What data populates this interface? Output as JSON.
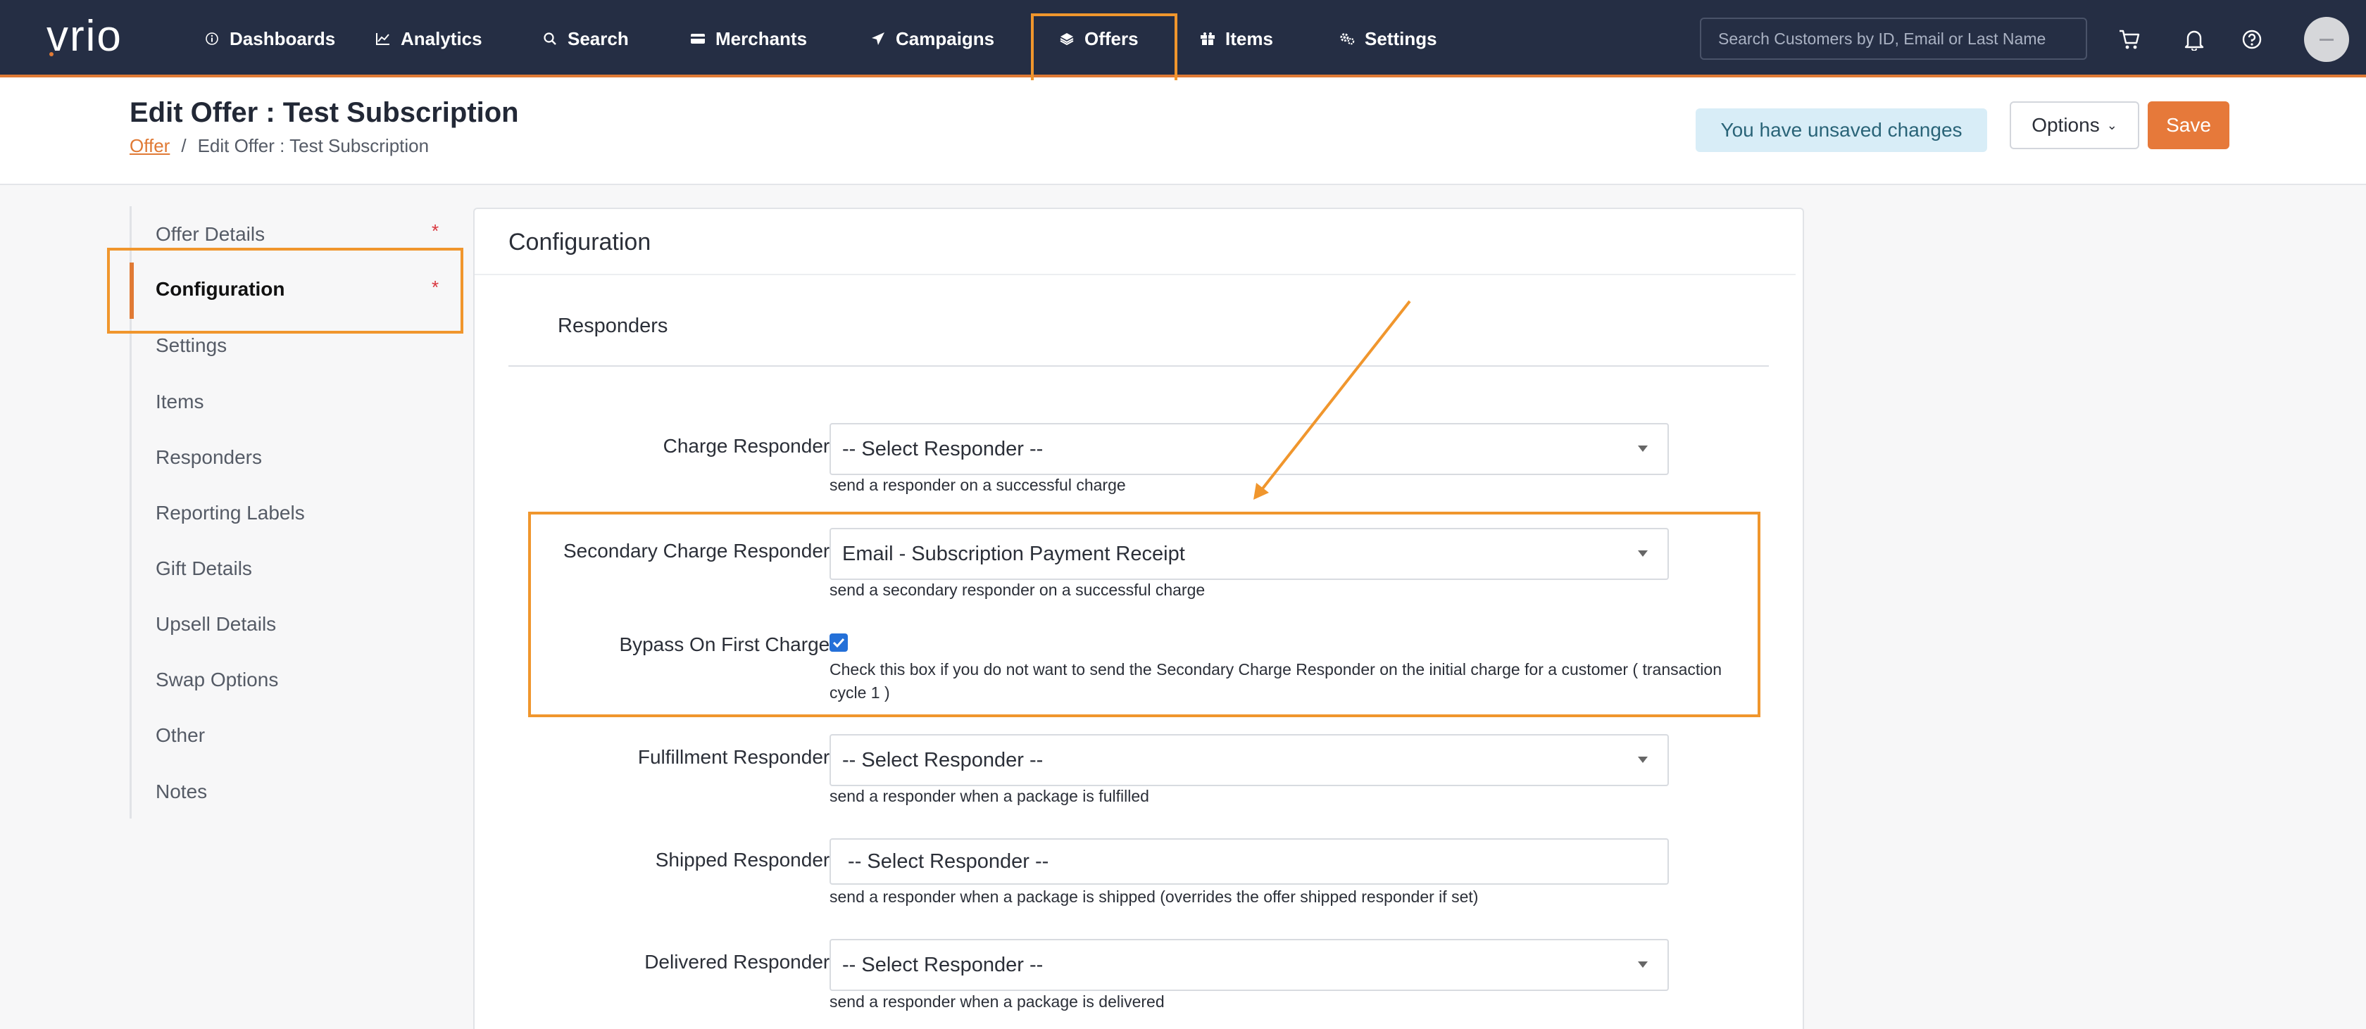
{
  "app": {
    "logo_text": "vrio"
  },
  "nav": {
    "items": [
      {
        "label": "Dashboards",
        "icon": "info-circle-icon"
      },
      {
        "label": "Analytics",
        "icon": "line-chart-icon"
      },
      {
        "label": "Search",
        "icon": "search-icon"
      },
      {
        "label": "Merchants",
        "icon": "credit-card-icon"
      },
      {
        "label": "Campaigns",
        "icon": "paper-plane-icon"
      },
      {
        "label": "Offers",
        "icon": "layers-icon"
      },
      {
        "label": "Items",
        "icon": "gift-icon"
      },
      {
        "label": "Settings",
        "icon": "gears-icon"
      }
    ],
    "search_placeholder": "Search Customers by ID, Email or Last Name",
    "highlighted_item": "Offers"
  },
  "header": {
    "title": "Edit Offer : Test Subscription",
    "breadcrumb": {
      "link": "Offer",
      "separator": "/",
      "current": "Edit Offer : Test Subscription"
    },
    "unsaved_notice": "You have unsaved changes",
    "options_label": "Options",
    "save_label": "Save"
  },
  "sidenav": {
    "items": [
      {
        "label": "Offer Details",
        "required": "*"
      },
      {
        "label": "Configuration",
        "required": "*",
        "active": true
      },
      {
        "label": "Settings"
      },
      {
        "label": "Items"
      },
      {
        "label": "Responders"
      },
      {
        "label": "Reporting Labels"
      },
      {
        "label": "Gift Details"
      },
      {
        "label": "Upsell Details"
      },
      {
        "label": "Swap Options"
      },
      {
        "label": "Other"
      },
      {
        "label": "Notes"
      }
    ]
  },
  "panel": {
    "title": "Configuration",
    "section": "Responders",
    "fields": {
      "charge": {
        "label": "Charge Responder:",
        "value": "-- Select Responder --",
        "help": "send a responder on a successful charge"
      },
      "secondary": {
        "label": "Secondary Charge Responder:",
        "value": "Email - Subscription Payment Receipt",
        "help": "send a secondary responder on a successful charge"
      },
      "bypass": {
        "label": "Bypass On First Charge:",
        "checked": true,
        "help": "Check this box if you do not want to send the Secondary Charge Responder on the initial charge for a customer ( transaction cycle 1 )"
      },
      "fulfillment": {
        "label": "Fulfillment Responder:",
        "value": "-- Select Responder --",
        "help": "send a responder when a package is fulfilled"
      },
      "shipped": {
        "label": "Shipped Responder:",
        "value": " -- Select Responder --",
        "help": "send a responder when a package is shipped (overrides the offer shipped responder if set)"
      },
      "delivered": {
        "label": "Delivered Responder:",
        "value": "-- Select Responder --",
        "help": "send a responder when a package is delivered"
      }
    }
  },
  "colors": {
    "nav_bg": "#252e44",
    "accent": "#e07a35",
    "annotation": "#f0962d",
    "checkbox": "#2470d8"
  }
}
